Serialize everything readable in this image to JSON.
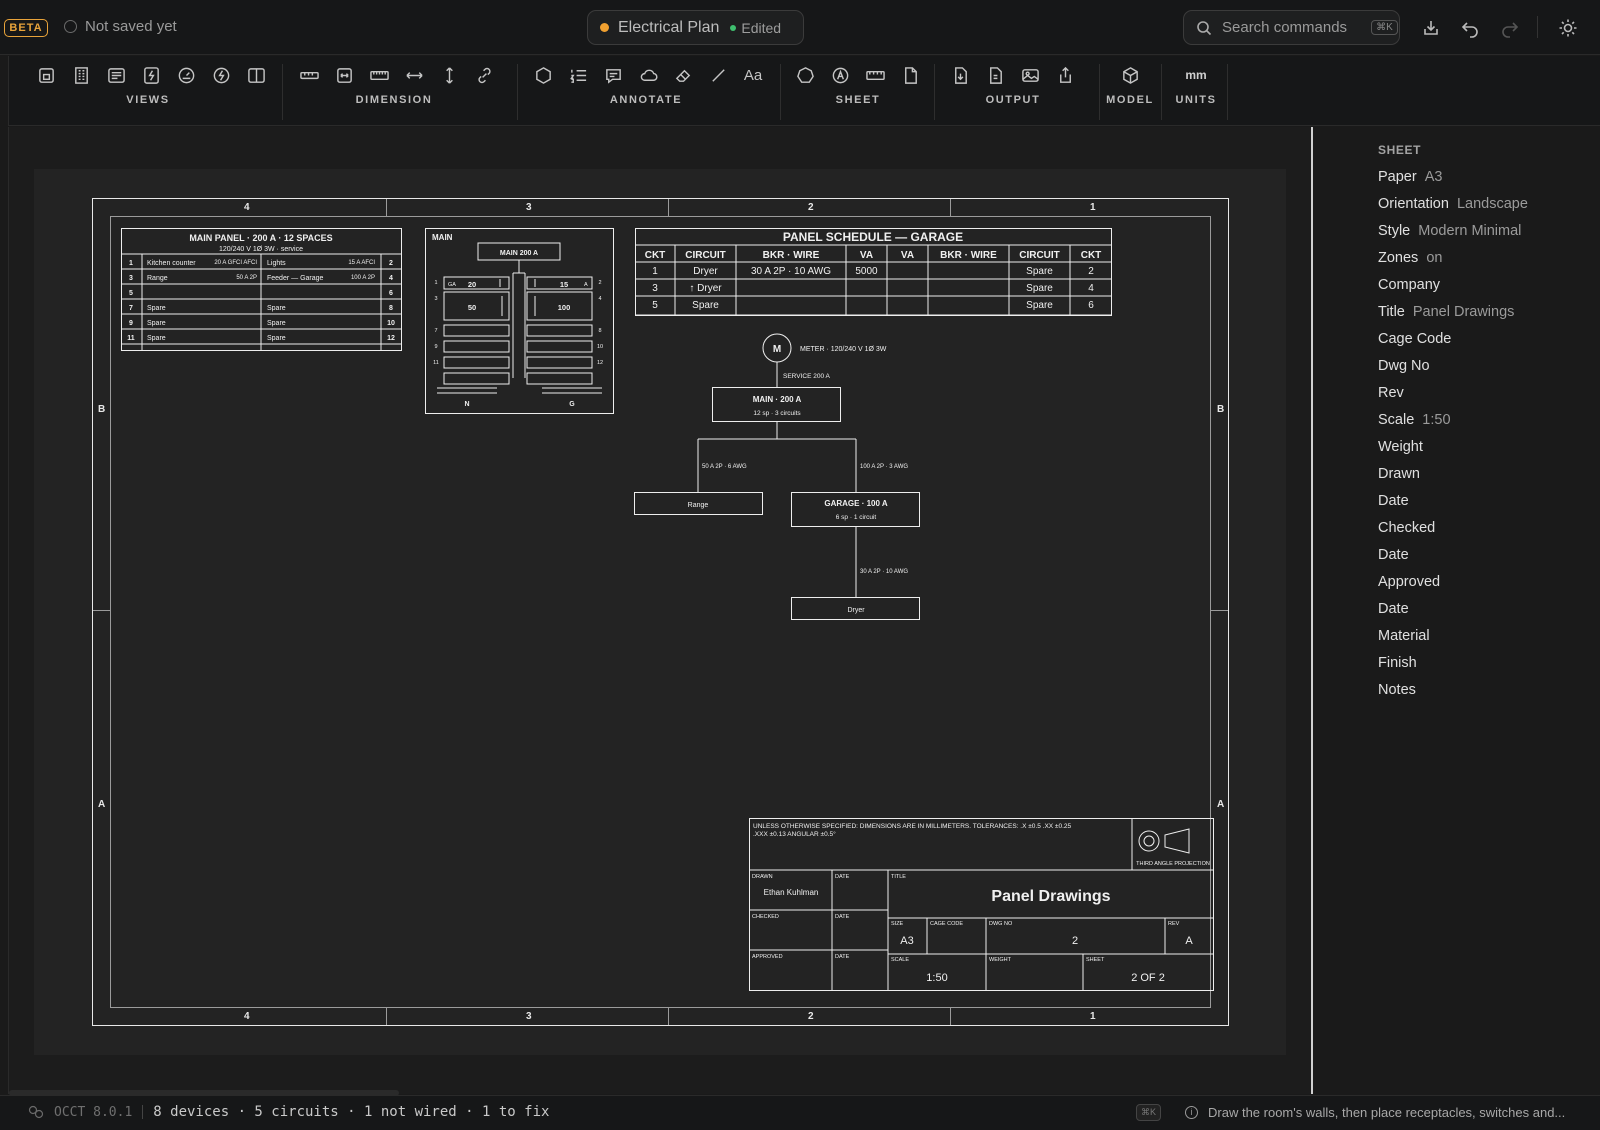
{
  "topbar": {
    "beta_label": "BETA",
    "save_status": "Not saved yet",
    "document_title": "Electrical Plan",
    "document_state": "Edited",
    "search_placeholder": "Search commands",
    "search_shortcut": "⌘K"
  },
  "toolbar": {
    "groups": [
      {
        "label": "VIEWS",
        "icons": [
          "sheet-view-icon",
          "building-icon",
          "list-view-icon",
          "electrical-panel-icon",
          "meter-icon",
          "lightning-icon",
          "split-view-icon"
        ]
      },
      {
        "label": "DIMENSION",
        "icons": [
          "ruler-icon",
          "fit-dimension-icon",
          "ruler-alt-icon",
          "horizontal-dimension-icon",
          "vertical-dimension-icon",
          "link-icon"
        ]
      },
      {
        "label": "ANNOTATE",
        "icons": [
          "hexagon-icon",
          "numbered-list-icon",
          "comment-icon",
          "cloud-icon",
          "eraser-icon",
          "line-icon",
          "text-icon"
        ]
      },
      {
        "label": "SHEET",
        "icons": [
          "shape-icon",
          "stamp-icon",
          "title-block-icon",
          "page-icon"
        ]
      },
      {
        "label": "OUTPUT",
        "icons": [
          "export-pdf-icon",
          "export-file-icon",
          "export-image-icon",
          "share-icon"
        ]
      },
      {
        "label": "MODEL",
        "icons": [
          "cube-icon"
        ]
      },
      {
        "label": "UNITS",
        "icons": [
          "units-mm"
        ]
      }
    ],
    "text_icon_label": "Aa",
    "units_value": "mm"
  },
  "drawing": {
    "zones_top": [
      "4",
      "3",
      "2",
      "1"
    ],
    "zones_bottom": [
      "4",
      "3",
      "2",
      "1"
    ],
    "zones_left": [
      "B",
      "A"
    ],
    "zones_right": [
      "B",
      "A"
    ],
    "main_panel": {
      "title": "MAIN PANEL · 200 A · 12 SPACES",
      "subtitle": "120/240 V 1Ø 3W · service",
      "rows": [
        {
          "l_ckt": "1",
          "l_name": "Kitchen counter",
          "l_brk": "20 A GFCI AFCI",
          "r_name": "Lights",
          "r_brk": "15 A AFCI",
          "r_ckt": "2"
        },
        {
          "l_ckt": "3",
          "l_name": "Range",
          "l_brk": "50 A 2P",
          "r_name": "Feeder — Garage",
          "r_brk": "100 A 2P",
          "r_ckt": "4"
        },
        {
          "l_ckt": "5",
          "l_name": "",
          "l_brk": "",
          "r_name": "",
          "r_brk": "",
          "r_ckt": "6"
        },
        {
          "l_ckt": "7",
          "l_name": "Spare",
          "l_brk": "",
          "r_name": "Spare",
          "r_brk": "",
          "r_ckt": "8"
        },
        {
          "l_ckt": "9",
          "l_name": "Spare",
          "l_brk": "",
          "r_name": "Spare",
          "r_brk": "",
          "r_ckt": "10"
        },
        {
          "l_ckt": "11",
          "l_name": "Spare",
          "l_brk": "",
          "r_name": "Spare",
          "r_brk": "",
          "r_ckt": "12"
        }
      ]
    },
    "panel_elevation": {
      "label": "MAIN",
      "main_breaker": "MAIN 200 A",
      "left_nums": [
        "1",
        "3",
        "7",
        "9",
        "11"
      ],
      "right_nums": [
        "2",
        "4",
        "8",
        "10",
        "12"
      ],
      "b1_left": "GA",
      "b1_val": "20",
      "b2_val": "15",
      "b2_right": "A",
      "b3_val": "50",
      "b4_val": "100",
      "neutral": "N",
      "ground": "G"
    },
    "schedule": {
      "title": "PANEL SCHEDULE — GARAGE",
      "headers": [
        "CKT",
        "CIRCUIT",
        "BKR · WIRE",
        "VA",
        "VA",
        "BKR · WIRE",
        "CIRCUIT",
        "CKT"
      ],
      "rows": [
        [
          "1",
          "Dryer",
          "30 A 2P · 10 AWG",
          "5000",
          "",
          "",
          "Spare",
          "2"
        ],
        [
          "3",
          "↑ Dryer",
          "",
          "",
          "",
          "",
          "Spare",
          "4"
        ],
        [
          "5",
          "Spare",
          "",
          "",
          "",
          "",
          "Spare",
          "6"
        ]
      ]
    },
    "riser": {
      "meter_symbol": "M",
      "meter_label": "METER · 120/240 V 1Ø 3W",
      "service_label": "SERVICE 200 A",
      "main_title": "MAIN · 200 A",
      "main_sub": "12 sp · 3 circuits",
      "left_wire": "50 A 2P · 6 AWG",
      "right_wire": "100 A 2P · 3 AWG",
      "range_label": "Range",
      "garage_title": "GARAGE · 100 A",
      "garage_sub": "6 sp · 1 circuit",
      "dryer_wire": "30 A 2P · 10 AWG",
      "dryer_label": "Dryer"
    },
    "title_block": {
      "note": "UNLESS OTHERWISE SPECIFIED: DIMENSIONS ARE IN MILLIMETERS. TOLERANCES: .X ±0.5 .XX ±0.25 .XXX ±0.13 ANGULAR ±0.5°",
      "projection_label": "THIRD ANGLE PROJECTION",
      "drawn_label": "DRAWN",
      "drawn_value": "Ethan Kuhlman",
      "checked_label": "CHECKED",
      "approved_label": "APPROVED",
      "date_label": "DATE",
      "title_label": "TITLE",
      "title_value": "Panel Drawings",
      "size_label": "SIZE",
      "size_value": "A3",
      "cage_label": "CAGE CODE",
      "cage_value": "",
      "dwg_label": "DWG NO",
      "dwg_value": "2",
      "rev_label": "REV",
      "rev_value": "A",
      "scale_label": "SCALE",
      "scale_value": "1:50",
      "weight_label": "WEIGHT",
      "weight_value": "",
      "sheet_label": "SHEET",
      "sheet_value": "2 OF 2"
    }
  },
  "sidepanel": {
    "heading": "SHEET",
    "rows": [
      {
        "label": "Paper",
        "value": "A3"
      },
      {
        "label": "Orientation",
        "value": "Landscape"
      },
      {
        "label": "Style",
        "value": "Modern Minimal"
      },
      {
        "label": "Zones",
        "value": "on"
      },
      {
        "label": "Company",
        "value": ""
      },
      {
        "label": "Title",
        "value": "Panel Drawings"
      },
      {
        "label": "Cage Code",
        "value": ""
      },
      {
        "label": "Dwg No",
        "value": ""
      },
      {
        "label": "Rev",
        "value": ""
      },
      {
        "label": "Scale",
        "value": "1:50"
      },
      {
        "label": "Weight",
        "value": ""
      },
      {
        "label": "Drawn",
        "value": ""
      },
      {
        "label": "Date",
        "value": ""
      },
      {
        "label": "Checked",
        "value": ""
      },
      {
        "label": "Date",
        "value": ""
      },
      {
        "label": "Approved",
        "value": ""
      },
      {
        "label": "Date",
        "value": ""
      },
      {
        "label": "Material",
        "value": ""
      },
      {
        "label": "Finish",
        "value": ""
      },
      {
        "label": "Notes",
        "value": ""
      }
    ]
  },
  "statusbar": {
    "engine": "OCCT 8.0.1",
    "summary": "8 devices · 5 circuits · 1 not wired · 1 to fix",
    "shortcut": "⌘K",
    "hint": "Draw the room's walls, then place receptacles, switches and..."
  }
}
